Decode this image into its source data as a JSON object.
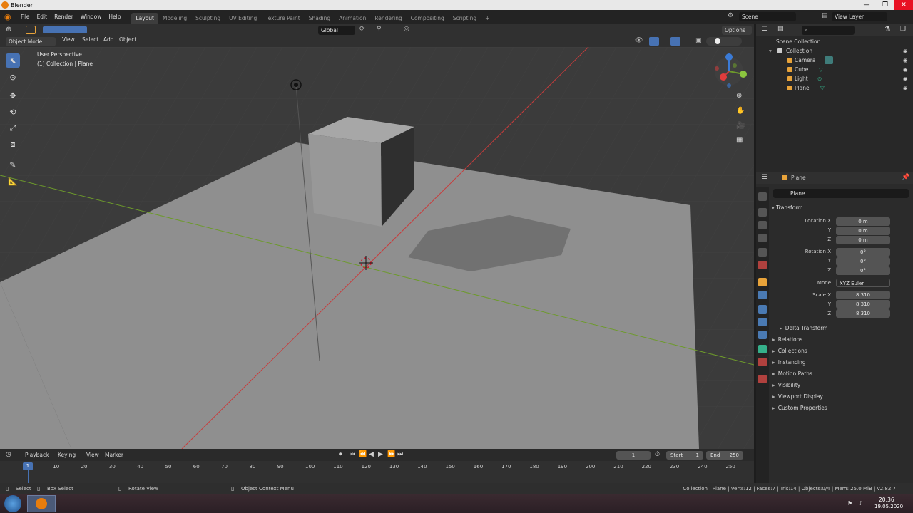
{
  "window": {
    "title": "Blender",
    "controls": [
      "—",
      "❐",
      "✕"
    ]
  },
  "topbar": {
    "menus": [
      "File",
      "Edit",
      "Render",
      "Window",
      "Help"
    ],
    "workspaces": [
      "Layout",
      "Modeling",
      "Sculpting",
      "UV Editing",
      "Texture Paint",
      "Shading",
      "Animation",
      "Rendering",
      "Compositing",
      "Scripting"
    ],
    "active_workspace": "Layout",
    "add_tab": "+",
    "scene": "Scene",
    "view_layer": "View Layer"
  },
  "viewport_header": {
    "mode": "Object Mode",
    "menus": [
      "View",
      "Select",
      "Add",
      "Object"
    ],
    "orientation": "Global",
    "options": "Options"
  },
  "viewport": {
    "perspective_label": "User Perspective",
    "collection_label": "(1) Collection | Plane"
  },
  "outliner": {
    "search_placeholder": "",
    "scene_collection": "Scene Collection",
    "collection": "Collection",
    "items": [
      "Camera",
      "Cube",
      "Light",
      "Plane"
    ]
  },
  "properties": {
    "header_object": "Plane",
    "object_name": "Plane",
    "transform_label": "Transform",
    "location": {
      "label_x": "Location X",
      "label_y": "Y",
      "label_z": "Z",
      "x": "0 m",
      "y": "0 m",
      "z": "0 m"
    },
    "rotation": {
      "label_x": "Rotation X",
      "label_y": "Y",
      "label_z": "Z",
      "x": "0°",
      "y": "0°",
      "z": "0°"
    },
    "mode": {
      "label": "Mode",
      "value": "XYZ Euler"
    },
    "scale": {
      "label_x": "Scale X",
      "label_y": "Y",
      "label_z": "Z",
      "x": "8.310",
      "y": "8.310",
      "z": "8.310"
    },
    "delta_transform": "Delta Transform",
    "sections": [
      "Relations",
      "Collections",
      "Instancing",
      "Motion Paths",
      "Visibility",
      "Viewport Display",
      "Custom Properties"
    ]
  },
  "timeline": {
    "menus": [
      "Playback",
      "Keying",
      "View",
      "Marker"
    ],
    "current_frame": "1",
    "start_label": "Start",
    "start": "1",
    "end_label": "End",
    "end": "250",
    "ticks": [
      "1",
      "10",
      "20",
      "30",
      "40",
      "50",
      "60",
      "70",
      "80",
      "90",
      "100",
      "110",
      "120",
      "130",
      "140",
      "150",
      "160",
      "170",
      "180",
      "190",
      "200",
      "210",
      "220",
      "230",
      "240",
      "250"
    ]
  },
  "statusbar": {
    "select": "Select",
    "box_select": "Box Select",
    "rotate_view": "Rotate View",
    "context_menu": "Object Context Menu",
    "stats": "Collection | Plane | Verts:12 | Faces:7 | Tris:14 | Objects:0/4 | Mem: 25.0 MiB | v2.82.7"
  },
  "taskbar": {
    "time": "20:36",
    "date": "19.05.2020"
  },
  "colors": {
    "accent": "#4772b3",
    "x_axis": "#c83c3c",
    "y_axis": "#6d9a2b",
    "z_axis": "#3b7bd6",
    "blender_orange": "#e87d0d"
  }
}
